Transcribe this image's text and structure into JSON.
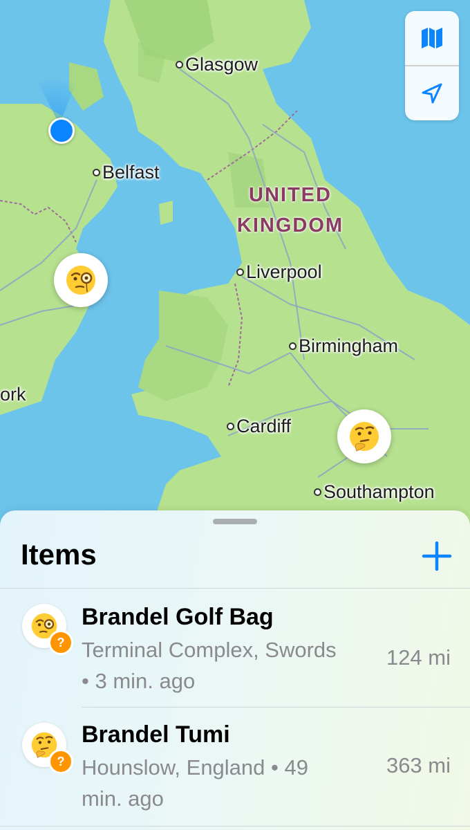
{
  "map": {
    "cities": [
      {
        "name": "Glasgow"
      },
      {
        "name": "Belfast"
      },
      {
        "name": "Liverpool"
      },
      {
        "name": "Birmingham"
      },
      {
        "name": "Cardiff"
      },
      {
        "name": "Southampton"
      },
      {
        "name": "ork"
      }
    ],
    "country": {
      "line1": "UNITED",
      "line2": "KINGDOM"
    },
    "controls": {
      "map_mode_icon": "map-icon",
      "location_icon": "location-arrow-icon"
    }
  },
  "sheet": {
    "title": "Items",
    "add_icon": "plus-icon",
    "items": [
      {
        "name": "Brandel Golf Bag",
        "location": "Terminal Complex, Swords",
        "time": "• 3 min. ago",
        "distance": "124 mi",
        "emoji": "face-with-monocle",
        "status_badge": "?"
      },
      {
        "name": "Brandel Tumi",
        "location": "Hounslow, England",
        "time": "• 49 min. ago",
        "distance": "363 mi",
        "emoji": "thinking-face",
        "status_badge": "?"
      }
    ]
  },
  "colors": {
    "accent": "#0a84ff",
    "badge": "#ff9500",
    "land": "#b6e18f",
    "water": "#6cc4ea",
    "country_label": "#8a3a63"
  }
}
